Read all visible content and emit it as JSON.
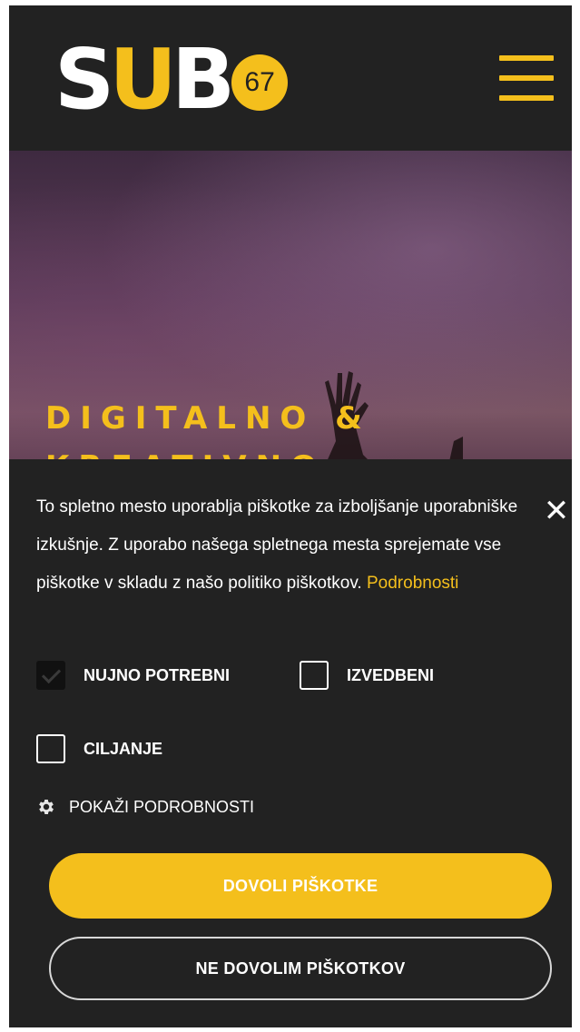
{
  "header": {
    "logo_letters": [
      "S",
      "U",
      "B"
    ],
    "logo_badge": "67",
    "menu_icon": "hamburger-menu-icon"
  },
  "hero": {
    "title": "DIGITALNO & KREATIVNO"
  },
  "cookie_banner": {
    "text": "To spletno mesto uporablja piškotke za izboljšanje uporabniške izkušnje. Z uporabo našega spletnega mesta sprejemate vse piškotke v skladu z našo politiko piškotkov.",
    "details_link": "Podrobnosti",
    "options": [
      {
        "label": "NUJNO POTREBNI",
        "checked": true
      },
      {
        "label": "IZVEDBENI",
        "checked": false
      },
      {
        "label": "CILJANJE",
        "checked": false
      }
    ],
    "show_details": "POKAŽI PODROBNOSTI",
    "allow_button": "DOVOLI PIŠKOTKE",
    "deny_button": "NE DOVOLIM PIŠKOTKOV",
    "close_icon": "close-icon"
  },
  "colors": {
    "accent": "#f4bf1c",
    "background": "#222222",
    "text": "#ffffff"
  }
}
